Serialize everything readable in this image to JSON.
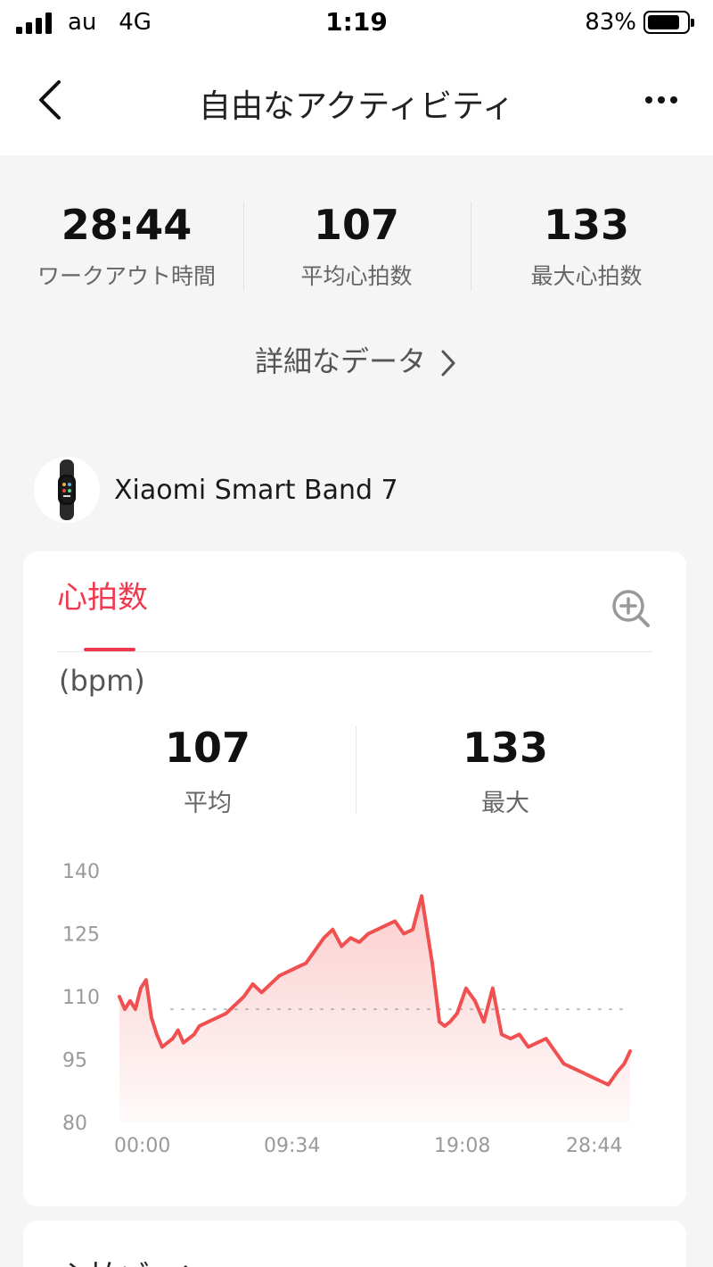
{
  "status_bar": {
    "carrier": "au   4G",
    "time": "1:19",
    "battery": "83%",
    "battery_level": 0.83,
    "signal_bars": 4
  },
  "nav": {
    "back_icon": "chevron-left-icon",
    "title": "自由なアクティビティ",
    "more_icon": "more-horizontal-icon"
  },
  "summary": {
    "items": [
      {
        "value": "28:44",
        "label": "ワークアウト時間"
      },
      {
        "value": "107",
        "label": "平均心拍数"
      },
      {
        "value": "133",
        "label": "最大心拍数"
      }
    ],
    "details_link": "詳細なデータ"
  },
  "device": {
    "name": "Xiaomi Smart Band 7",
    "icon": "smart-band-icon"
  },
  "heart_rate_card": {
    "tab_label": "心拍数",
    "zoom_icon": "zoom-in-icon",
    "unit": "(bpm)",
    "stats": [
      {
        "value": "107",
        "label": "平均"
      },
      {
        "value": "133",
        "label": "最大"
      }
    ],
    "accent_color": "#f0394f",
    "line_color": "#f0504f"
  },
  "chart_data": {
    "type": "area",
    "y_ticks": [
      "140",
      "125",
      "110",
      "95",
      "80"
    ],
    "x_ticks": [
      "00:00",
      "09:34",
      "19:08",
      "28:44"
    ],
    "ylim": [
      80,
      140
    ],
    "average_line": 107,
    "x_unit": "minutes",
    "x": [
      0,
      0.3,
      0.6,
      0.9,
      1.2,
      1.5,
      1.8,
      2.1,
      2.4,
      2.7,
      3.0,
      3.3,
      3.6,
      3.9,
      4.2,
      4.5,
      5.0,
      5.5,
      6.0,
      6.5,
      7.0,
      7.5,
      8.0,
      8.5,
      9.0,
      9.5,
      10.0,
      10.5,
      11.0,
      11.5,
      12.0,
      12.5,
      13.0,
      13.5,
      14.0,
      14.5,
      15.0,
      15.5,
      16.0,
      16.5,
      17.0,
      17.3,
      17.6,
      18.0,
      18.3,
      18.6,
      19.0,
      19.5,
      20.0,
      20.5,
      21.0,
      21.5,
      22.0,
      22.5,
      23.0,
      23.5,
      24.0,
      24.5,
      25.0,
      25.5,
      26.0,
      26.5,
      27.0,
      27.5,
      28.0,
      28.4,
      28.73
    ],
    "values": [
      110,
      107,
      109,
      107,
      112,
      114,
      105,
      101,
      98,
      99,
      100,
      102,
      99,
      100,
      101,
      103,
      104,
      105,
      106,
      108,
      110,
      113,
      111,
      113,
      115,
      116,
      117,
      118,
      121,
      124,
      126,
      122,
      124,
      123,
      125,
      126,
      127,
      128,
      125,
      126,
      134,
      126,
      118,
      104,
      103,
      104,
      106,
      112,
      109,
      104,
      112,
      101,
      100,
      101,
      98,
      99,
      100,
      97,
      94,
      93,
      92,
      91,
      90,
      89,
      92,
      94,
      97
    ]
  },
  "zone_card": {
    "title": "心拍ゾーン"
  }
}
